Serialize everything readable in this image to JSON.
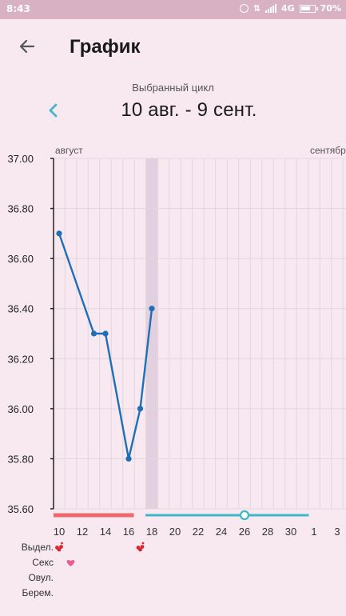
{
  "status_bar": {
    "time": "8:43",
    "network": "4G",
    "battery": "70%"
  },
  "header": {
    "title": "График",
    "back_icon": "arrow-left-icon"
  },
  "cycle": {
    "caption": "Выбранный цикл",
    "range": "10 авг. - 9 сент.",
    "prev_icon": "chevron-left-icon",
    "accent_color": "#3fb8c9"
  },
  "chart_data": {
    "type": "line",
    "title": "",
    "xlabel": "",
    "ylabel": "",
    "ylim": [
      35.6,
      37.0
    ],
    "y_ticks": [
      "37.00",
      "36.80",
      "36.60",
      "36.40",
      "36.20",
      "36.00",
      "35.80",
      "35.60"
    ],
    "month_labels": [
      "август",
      "сентябр"
    ],
    "x_tick_labels": [
      "10",
      "12",
      "14",
      "16",
      "18",
      "20",
      "22",
      "24",
      "26",
      "28",
      "30",
      "1",
      "3"
    ],
    "series": [
      {
        "color": "#1f6fb5",
        "points": [
          {
            "day": 10,
            "value": 36.7
          },
          {
            "day": 13,
            "value": 36.3
          },
          {
            "day": 14,
            "value": 36.3
          },
          {
            "day": 16,
            "value": 35.8
          },
          {
            "day": 17,
            "value": 36.0
          },
          {
            "day": 18,
            "value": 36.4
          }
        ]
      }
    ],
    "highlight_day": 18,
    "period_bar": {
      "start_day": 10,
      "end_day": 17,
      "color": "#ee6a6a"
    },
    "cycle_bar": {
      "start_day": 18,
      "end_day": 31,
      "color": "#3fb8c9"
    },
    "ovulation_day": 26,
    "grid": true
  },
  "markers": {
    "rows": [
      "Выдел.",
      "Секс",
      "Овул.",
      "Берем."
    ],
    "discharge_days": [
      10,
      17
    ],
    "sex_days": [
      11
    ],
    "discharge_color": "#d8262c",
    "sex_color": "#ef5d8f"
  }
}
